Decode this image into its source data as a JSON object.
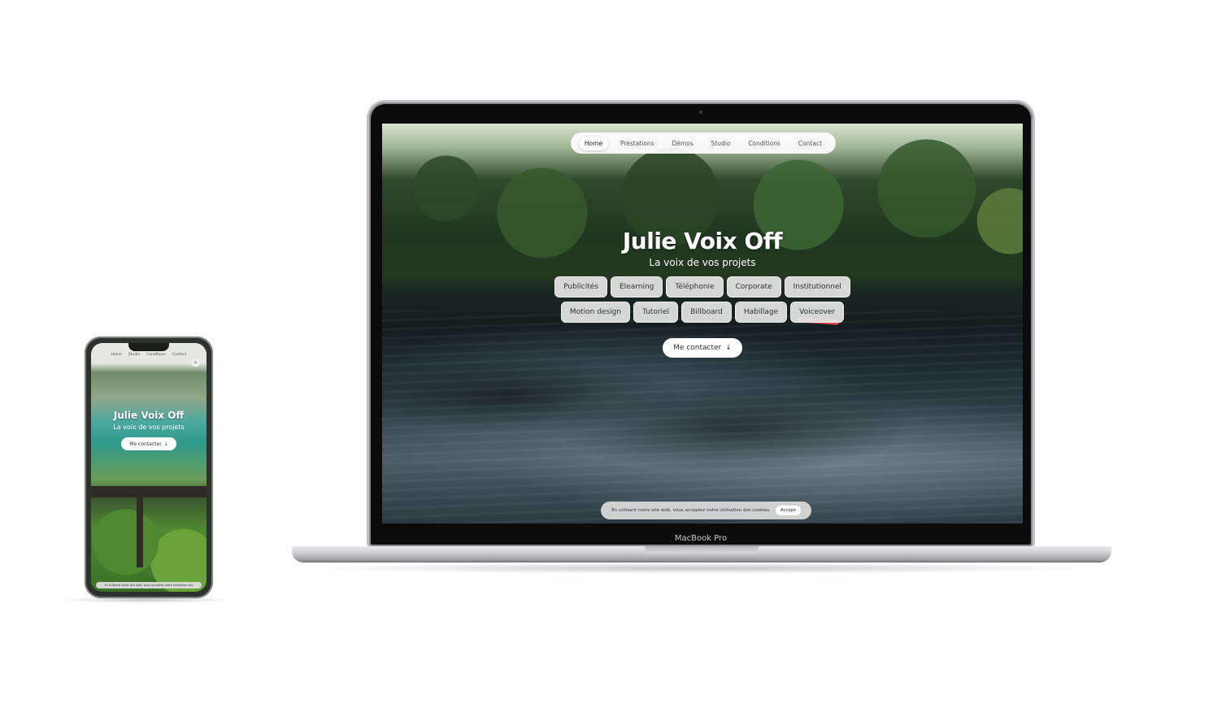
{
  "laptop": {
    "brand_label": "MacBook Pro",
    "nav": {
      "items": [
        "Home",
        "Prestations",
        "Démos",
        "Studio",
        "Conditions",
        "Contact"
      ],
      "active": "Home"
    },
    "hero": {
      "title": "Julie Voix Off",
      "subtitle": "La voix de vos projets"
    },
    "chips_row1": [
      "Publicités",
      "Elearning",
      "Téléphonie",
      "Corporate",
      "Institutionnel"
    ],
    "chips_row2": [
      "Motion design",
      "Tutoriel",
      "Billboard",
      "Habillage",
      "Voiceover"
    ],
    "contact_button": {
      "label": "Me contacter",
      "icon": "arrow-down-icon"
    },
    "cookie_bar": {
      "text": "En utilisant notre site web, vous acceptez notre utilisation des cookies.",
      "accept_label": "Accept"
    }
  },
  "phone": {
    "nav_items": [
      "Home",
      "Studio",
      "Conditions",
      "Contact"
    ],
    "hero": {
      "title": "Julie Voix Off",
      "subtitle": "La voix de vos projets"
    },
    "contact_button": {
      "label": "Me contacter",
      "icon": "arrow-down-icon"
    },
    "cookie_bar": {
      "text": "En utilisant notre site web, vous acceptez notre utilisation des"
    },
    "settings_icon": "gear-icon"
  }
}
